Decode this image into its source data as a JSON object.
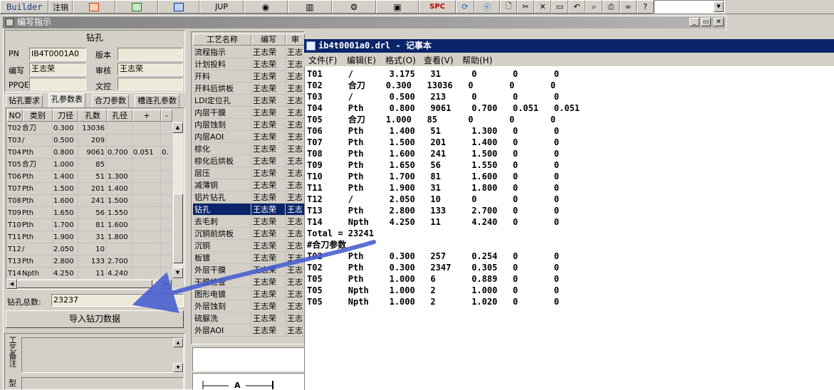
{
  "toolbar": {
    "builder": "Builder",
    "logout": "注销",
    "jup": "JUP",
    "spc": "SPC"
  },
  "editor": {
    "title": "编写指示",
    "section_title": "钻孔",
    "pn_label": "PN",
    "pn_value": "IB4T0001A0",
    "version_label": "版本",
    "version_value": "",
    "author_label": "编写",
    "author_value": "王志荣",
    "reviewer_label": "审核",
    "reviewer_value": "王志荣",
    "ppqe_label": "PPQE",
    "ppqe_value": "",
    "doc_label": "文控",
    "doc_value": "",
    "tabs": [
      "钻孔要求",
      "孔参数表",
      "合刀参数",
      "槽连孔参数"
    ],
    "grid_headers": [
      "NO",
      "类别",
      "刀径",
      "孔数",
      "孔径",
      "+",
      "-"
    ],
    "grid_rows": [
      [
        "T02",
        "合刀",
        "0.300",
        "13036",
        "",
        "",
        ""
      ],
      [
        "T03",
        "/",
        "0.500",
        "209",
        "",
        "",
        ""
      ],
      [
        "T04",
        "Pth",
        "0.800",
        "9061",
        "0.700",
        "0.051",
        "0."
      ],
      [
        "T05",
        "合刀",
        "1.000",
        "85",
        "",
        "",
        ""
      ],
      [
        "T06",
        "Pth",
        "1.400",
        "51",
        "1.300",
        "",
        ""
      ],
      [
        "T07",
        "Pth",
        "1.500",
        "201",
        "1.400",
        "",
        ""
      ],
      [
        "T08",
        "Pth",
        "1.600",
        "241",
        "1.500",
        "",
        ""
      ],
      [
        "T09",
        "Pth",
        "1.650",
        "56",
        "1.550",
        "",
        ""
      ],
      [
        "T10",
        "Pth",
        "1.700",
        "81",
        "1.600",
        "",
        ""
      ],
      [
        "T11",
        "Pth",
        "1.900",
        "31",
        "1.800",
        "",
        ""
      ],
      [
        "T12",
        "/",
        "2.050",
        "10",
        "",
        "",
        ""
      ],
      [
        "T13",
        "Pth",
        "2.800",
        "133",
        "2.700",
        "",
        ""
      ],
      [
        "T14",
        "Npth",
        "4.250",
        "11",
        "4.240",
        "",
        ""
      ]
    ],
    "total_label": "钻孔总数:",
    "total_value": "23237",
    "import_button": "导入钻刀数据",
    "remark_label": "工艺备注",
    "type_label": "型"
  },
  "process": {
    "headers": [
      "工艺名称",
      "编写",
      "审"
    ],
    "rows": [
      [
        "流程指示",
        "王志荣",
        "王志"
      ],
      [
        "计划投料",
        "王志荣",
        "王志"
      ],
      [
        "开料",
        "王志荣",
        "王志"
      ],
      [
        "开料后烘板",
        "王志荣",
        "王志"
      ],
      [
        "LDI定位孔",
        "王志荣",
        "王志"
      ],
      [
        "内层干膜",
        "王志荣",
        "王志"
      ],
      [
        "内层蚀刻",
        "王志荣",
        "王志"
      ],
      [
        "内层AOI",
        "王志荣",
        "王志"
      ],
      [
        "棕化",
        "王志荣",
        "王志"
      ],
      [
        "棕化后烘板",
        "王志荣",
        "王志"
      ],
      [
        "层压",
        "王志荣",
        "王志"
      ],
      [
        "减薄铜",
        "王志荣",
        "王志"
      ],
      [
        "铝片钻孔",
        "王志荣",
        "王志"
      ],
      [
        "钻孔",
        "王志荣",
        "王志"
      ],
      [
        "去毛刺",
        "王志荣",
        "王志"
      ],
      [
        "沉铜前烘板",
        "王志荣",
        "王志"
      ],
      [
        "沉铜",
        "王志荣",
        "王志"
      ],
      [
        "板镀",
        "王志荣",
        "王志"
      ],
      [
        "外层干膜",
        "王志荣",
        "王志"
      ],
      [
        "干膜检查",
        "王志荣",
        "王志"
      ],
      [
        "图形电镀",
        "王志荣",
        "王志"
      ],
      [
        "外层蚀刻",
        "王志荣",
        "王志"
      ],
      [
        "硫脲洗",
        "王志荣",
        "王志"
      ],
      [
        "外层AOI",
        "王志荣",
        "王志"
      ]
    ],
    "selected_index": 13,
    "bottom_label": "A"
  },
  "notepad": {
    "title": "ib4t0001a0.drl - 记事本",
    "menu": [
      "文件(F)",
      "编辑(E)",
      "格式(O)",
      "查看(V)",
      "帮助(H)"
    ],
    "lines": [
      "T01     /       3.175   31      0       0       0",
      "T02     合刀    0.300   13036   0       0       0",
      "T03     /       0.500   213     0       0       0",
      "T04     Pth     0.800   9061    0.700   0.051   0.051",
      "T05     合刀    1.000   85      0       0       0",
      "T06     Pth     1.400   51      1.300   0       0",
      "T07     Pth     1.500   201     1.400   0       0",
      "T08     Pth     1.600   241     1.500   0       0",
      "T09     Pth     1.650   56      1.550   0       0",
      "T10     Pth     1.700   81      1.600   0       0",
      "T11     Pth     1.900   31      1.800   0       0",
      "T12     /       2.050   10      0       0       0",
      "T13     Pth     2.800   133     2.700   0       0",
      "T14     Npth    4.250   11      4.240   0       0",
      "Total = 23241",
      "#合刀参数",
      "T02     Pth     0.300   257     0.254   0       0",
      "T02     Pth     0.300   2347    0.305   0       0",
      "T05     Pth     1.000   6       0.889   0       0",
      "T05     Npth    1.000   2       1.000   0       0",
      "T05     Npth    1.000   2       1.020   0       0"
    ]
  },
  "colors": {
    "titlebar_active": "#0a246a",
    "arrow": "#4a5fd0"
  }
}
